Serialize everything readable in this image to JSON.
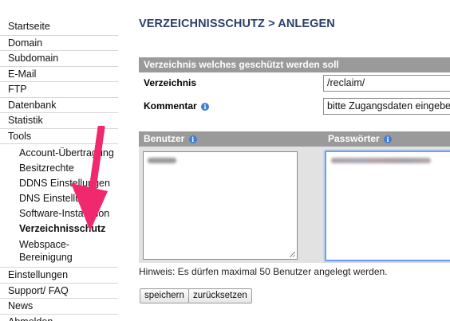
{
  "sidebar": {
    "items_top": [
      {
        "label": "Startseite"
      },
      {
        "label": "Domain"
      },
      {
        "label": "Subdomain"
      },
      {
        "label": "E-Mail"
      },
      {
        "label": "FTP"
      },
      {
        "label": "Datenbank"
      },
      {
        "label": "Statistik"
      },
      {
        "label": "Tools"
      }
    ],
    "tools_sub": [
      {
        "label": "Account-Übertragung"
      },
      {
        "label": "Besitzrechte"
      },
      {
        "label": "DDNS Einstellungen"
      },
      {
        "label": "DNS Einstellungen"
      },
      {
        "label": "Software-Installation"
      },
      {
        "label": "Verzeichnisschutz",
        "active": true
      },
      {
        "label": "Webspace-Bereinigung"
      }
    ],
    "items_bottom": [
      {
        "label": "Einstellungen"
      },
      {
        "label": "Support/ FAQ"
      },
      {
        "label": "News"
      },
      {
        "label": "Abmelden"
      }
    ]
  },
  "main": {
    "title": "VERZEICHNISSCHUTZ > ANLEGEN",
    "section1_header": "Verzeichnis welches geschützt werden soll",
    "verzeichnis_label": "Verzeichnis",
    "verzeichnis_value": "/reclaim/",
    "kommentar_label": "Kommentar",
    "kommentar_value": "bitte Zugangsdaten eingeben",
    "benutzer_header": "Benutzer",
    "passwoerter_header": "Passwörter",
    "info_glyph": "i",
    "hint": "Hinweis: Es dürfen maximal 50 Benutzer angelegt werden.",
    "save_button": "speichern",
    "reset_button": "zurücksetzen"
  },
  "colors": {
    "title": "#2a3f6d",
    "header_bar": "#9a9a9a",
    "panel_bg": "#e2e2e2",
    "info_icon": "#3d7fd6",
    "annotation_arrow": "#f0286e"
  }
}
